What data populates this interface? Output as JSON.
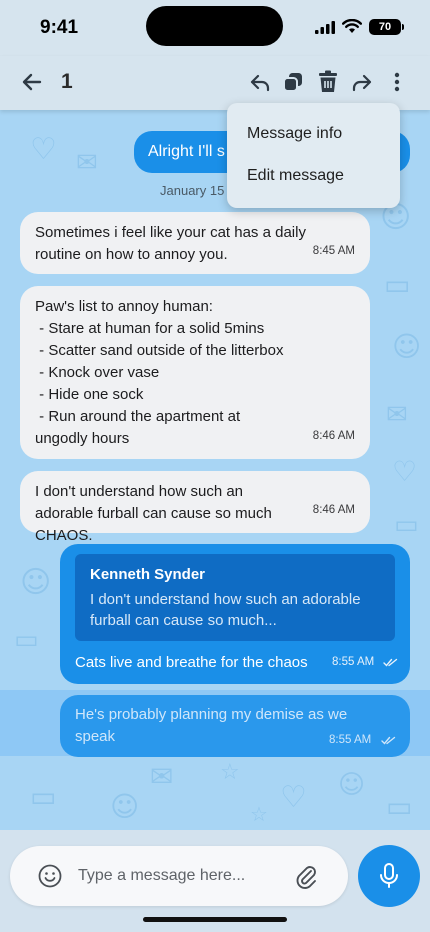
{
  "status_bar": {
    "time": "9:41",
    "battery": "70"
  },
  "header": {
    "selected_count": "1"
  },
  "menu": {
    "items": [
      "Message info",
      "Edit message"
    ]
  },
  "date_separator": "January 15",
  "messages": [
    {
      "direction": "outgoing",
      "text": "Alright I'll s",
      "partial": true
    },
    {
      "direction": "incoming",
      "text": "Sometimes i feel like your cat has a daily routine on how to annoy you.",
      "time": "8:45 AM"
    },
    {
      "direction": "incoming",
      "lines": [
        "Paw's list to annoy human:",
        " - Stare at human for a solid 5mins",
        " - Scatter sand outside of the litterbox",
        " - Knock over vase",
        " - Hide one sock",
        " - Run around the apartment at ungodly hours"
      ],
      "time": "8:46 AM"
    },
    {
      "direction": "incoming",
      "text": "I don't understand how such an adorable furball can cause so much CHAOS.",
      "time": "8:46 AM"
    },
    {
      "direction": "outgoing",
      "reply_to": {
        "author": "Kenneth Synder",
        "text": "I don't understand how such an adorable furball can cause so much..."
      },
      "text": "Cats live and breathe for the chaos",
      "time": "8:55 AM",
      "status": "read"
    },
    {
      "direction": "outgoing",
      "text": "He's probably planning my demise as we speak",
      "time": "8:55 AM",
      "status": "read",
      "selected": true
    }
  ],
  "composer": {
    "placeholder": "Type a message here..."
  },
  "icons": {
    "back": "back-arrow-icon",
    "reply": "reply-icon",
    "copy": "copy-icon",
    "delete": "trash-icon",
    "forward": "forward-icon",
    "more": "more-vertical-icon",
    "emoji": "emoji-icon",
    "attach": "paperclip-icon",
    "mic": "microphone-icon"
  },
  "colors": {
    "accent": "#1a8fe8",
    "incoming_bubble": "#f0f1f3",
    "chat_background": "#a8d5f4",
    "header": "#d6e4ee"
  }
}
